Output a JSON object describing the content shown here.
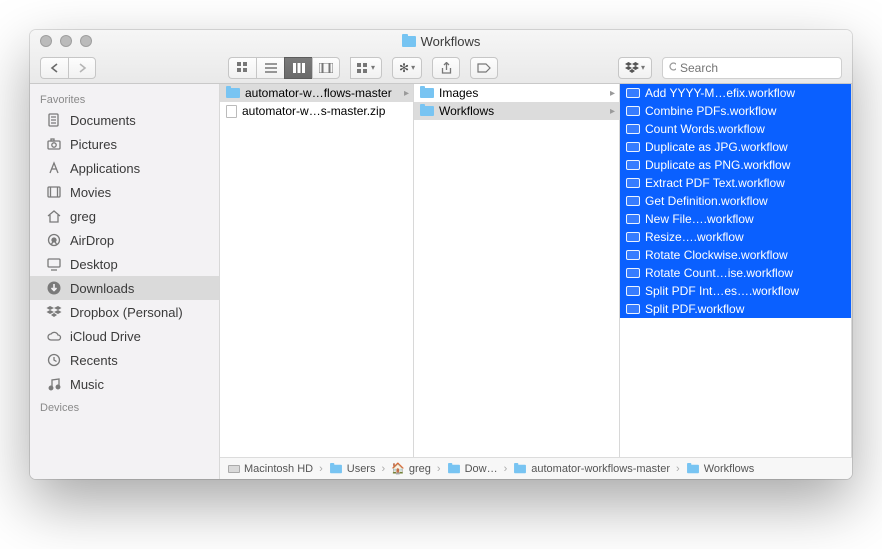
{
  "window": {
    "title": "Workflows"
  },
  "search": {
    "placeholder": "Search"
  },
  "sidebar": {
    "sections": [
      {
        "title": "Favorites",
        "items": [
          {
            "label": "Documents",
            "icon": "doc"
          },
          {
            "label": "Pictures",
            "icon": "camera"
          },
          {
            "label": "Applications",
            "icon": "app"
          },
          {
            "label": "Movies",
            "icon": "movie"
          },
          {
            "label": "greg",
            "icon": "home"
          },
          {
            "label": "AirDrop",
            "icon": "airdrop"
          },
          {
            "label": "Desktop",
            "icon": "desktop"
          },
          {
            "label": "Downloads",
            "icon": "downloads",
            "selected": true
          },
          {
            "label": "Dropbox (Personal)",
            "icon": "dropbox"
          },
          {
            "label": "iCloud Drive",
            "icon": "cloud"
          },
          {
            "label": "Recents",
            "icon": "recents"
          },
          {
            "label": "Music",
            "icon": "music"
          }
        ]
      },
      {
        "title": "Devices",
        "items": []
      }
    ]
  },
  "columns": [
    {
      "items": [
        {
          "label": "automator-w…flows-master",
          "type": "folder",
          "children": true,
          "selected": "gray"
        },
        {
          "label": "automator-w…s-master.zip",
          "type": "zip"
        }
      ]
    },
    {
      "items": [
        {
          "label": "Images",
          "type": "folder",
          "children": true
        },
        {
          "label": "Workflows",
          "type": "folder",
          "children": true,
          "selected": "gray"
        }
      ]
    },
    {
      "items": [
        {
          "label": "Add YYYY-M…efix.workflow",
          "type": "workflow",
          "selected": "blue"
        },
        {
          "label": "Combine PDFs.workflow",
          "type": "workflow",
          "selected": "blue"
        },
        {
          "label": "Count Words.workflow",
          "type": "workflow",
          "selected": "blue"
        },
        {
          "label": "Duplicate as JPG.workflow",
          "type": "workflow",
          "selected": "blue"
        },
        {
          "label": "Duplicate as PNG.workflow",
          "type": "workflow",
          "selected": "blue"
        },
        {
          "label": "Extract PDF Text.workflow",
          "type": "workflow",
          "selected": "blue"
        },
        {
          "label": "Get Definition.workflow",
          "type": "workflow",
          "selected": "blue"
        },
        {
          "label": "New File….workflow",
          "type": "workflow",
          "selected": "blue"
        },
        {
          "label": "Resize….workflow",
          "type": "workflow",
          "selected": "blue"
        },
        {
          "label": "Rotate Clockwise.workflow",
          "type": "workflow",
          "selected": "blue"
        },
        {
          "label": "Rotate Count…ise.workflow",
          "type": "workflow",
          "selected": "blue"
        },
        {
          "label": "Split PDF Int…es….workflow",
          "type": "workflow",
          "selected": "blue"
        },
        {
          "label": "Split PDF.workflow",
          "type": "workflow",
          "selected": "blue"
        }
      ]
    }
  ],
  "pathbar": [
    {
      "label": "Macintosh HD",
      "icon": "hd"
    },
    {
      "label": "Users",
      "icon": "folder"
    },
    {
      "label": "greg",
      "icon": "home"
    },
    {
      "label": "Dow…",
      "icon": "folder"
    },
    {
      "label": "automator-workflows-master",
      "icon": "folder"
    },
    {
      "label": "Workflows",
      "icon": "folder"
    }
  ]
}
